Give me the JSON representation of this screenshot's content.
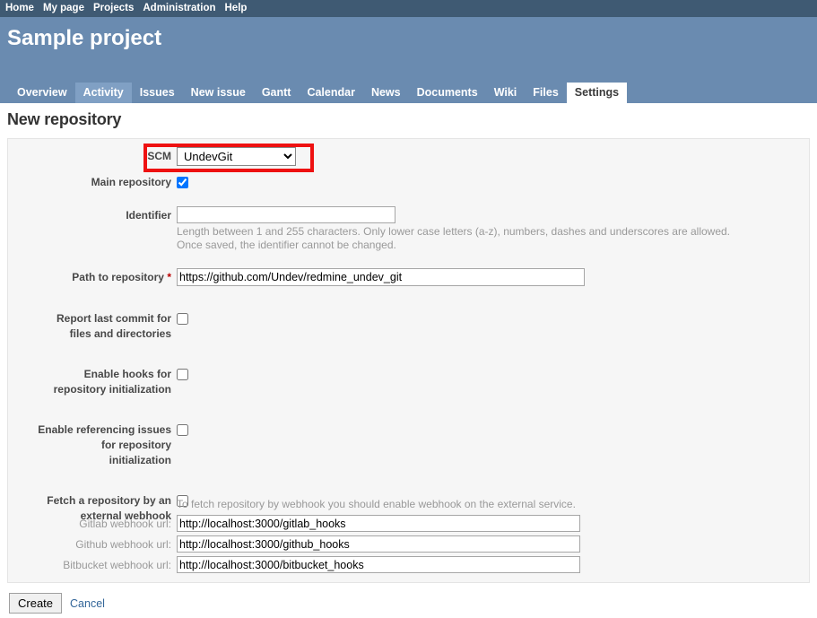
{
  "top_menu": {
    "items": [
      {
        "label": "Home",
        "name": "top-menu-home"
      },
      {
        "label": "My page",
        "name": "top-menu-my-page"
      },
      {
        "label": "Projects",
        "name": "top-menu-projects"
      },
      {
        "label": "Administration",
        "name": "top-menu-administration"
      },
      {
        "label": "Help",
        "name": "top-menu-help"
      }
    ]
  },
  "header": {
    "project_title": "Sample project",
    "background_color": "#6a8bb0",
    "top_bar_color": "#3f5a73"
  },
  "main_menu": {
    "tabs": [
      {
        "label": "Overview",
        "state": "normal"
      },
      {
        "label": "Activity",
        "state": "hover"
      },
      {
        "label": "Issues",
        "state": "normal"
      },
      {
        "label": "New issue",
        "state": "normal"
      },
      {
        "label": "Gantt",
        "state": "normal"
      },
      {
        "label": "Calendar",
        "state": "normal"
      },
      {
        "label": "News",
        "state": "normal"
      },
      {
        "label": "Documents",
        "state": "normal"
      },
      {
        "label": "Wiki",
        "state": "normal"
      },
      {
        "label": "Files",
        "state": "normal"
      },
      {
        "label": "Settings",
        "state": "selected"
      }
    ]
  },
  "page": {
    "title": "New repository"
  },
  "form": {
    "scm": {
      "label": "SCM",
      "selected": "UndevGit",
      "options": [
        "UndevGit"
      ],
      "highlight_color": "#ee1111"
    },
    "main_repository": {
      "label": "Main repository",
      "checked": true
    },
    "identifier": {
      "label": "Identifier",
      "value": "",
      "hint_line1": "Length between 1 and 255 characters. Only lower case letters (a-z), numbers, dashes and underscores are allowed.",
      "hint_line2": "Once saved, the identifier cannot be changed."
    },
    "path_to_repository": {
      "label": "Path to repository",
      "required_marker": "*",
      "value": "https://github.com/Undev/redmine_undev_git"
    },
    "report_last_commit": {
      "label_line1": "Report last commit for",
      "label_line2": "files and directories",
      "checked": false
    },
    "enable_hooks": {
      "label_line1": "Enable hooks for",
      "label_line2": "repository initialization",
      "checked": false
    },
    "enable_referencing_issues": {
      "label_line1": "Enable referencing issues",
      "label_line2": "for repository",
      "label_line3": "initialization",
      "checked": false
    },
    "fetch_by_webhook": {
      "label_line1": "Fetch a repository by an",
      "label_line2": "external webhook",
      "checked": false,
      "hint": "To fetch repository by webhook you should enable webhook on the external service."
    },
    "webhooks": [
      {
        "label": "Gitlab webhook url:",
        "value": "http://localhost:3000/gitlab_hooks",
        "name": "gitlab-webhook"
      },
      {
        "label": "Github webhook url:",
        "value": "http://localhost:3000/github_hooks",
        "name": "github-webhook"
      },
      {
        "label": "Bitbucket webhook url:",
        "value": "http://localhost:3000/bitbucket_hooks",
        "name": "bitbucket-webhook"
      }
    ]
  },
  "actions": {
    "create_label": "Create",
    "cancel_label": "Cancel"
  }
}
